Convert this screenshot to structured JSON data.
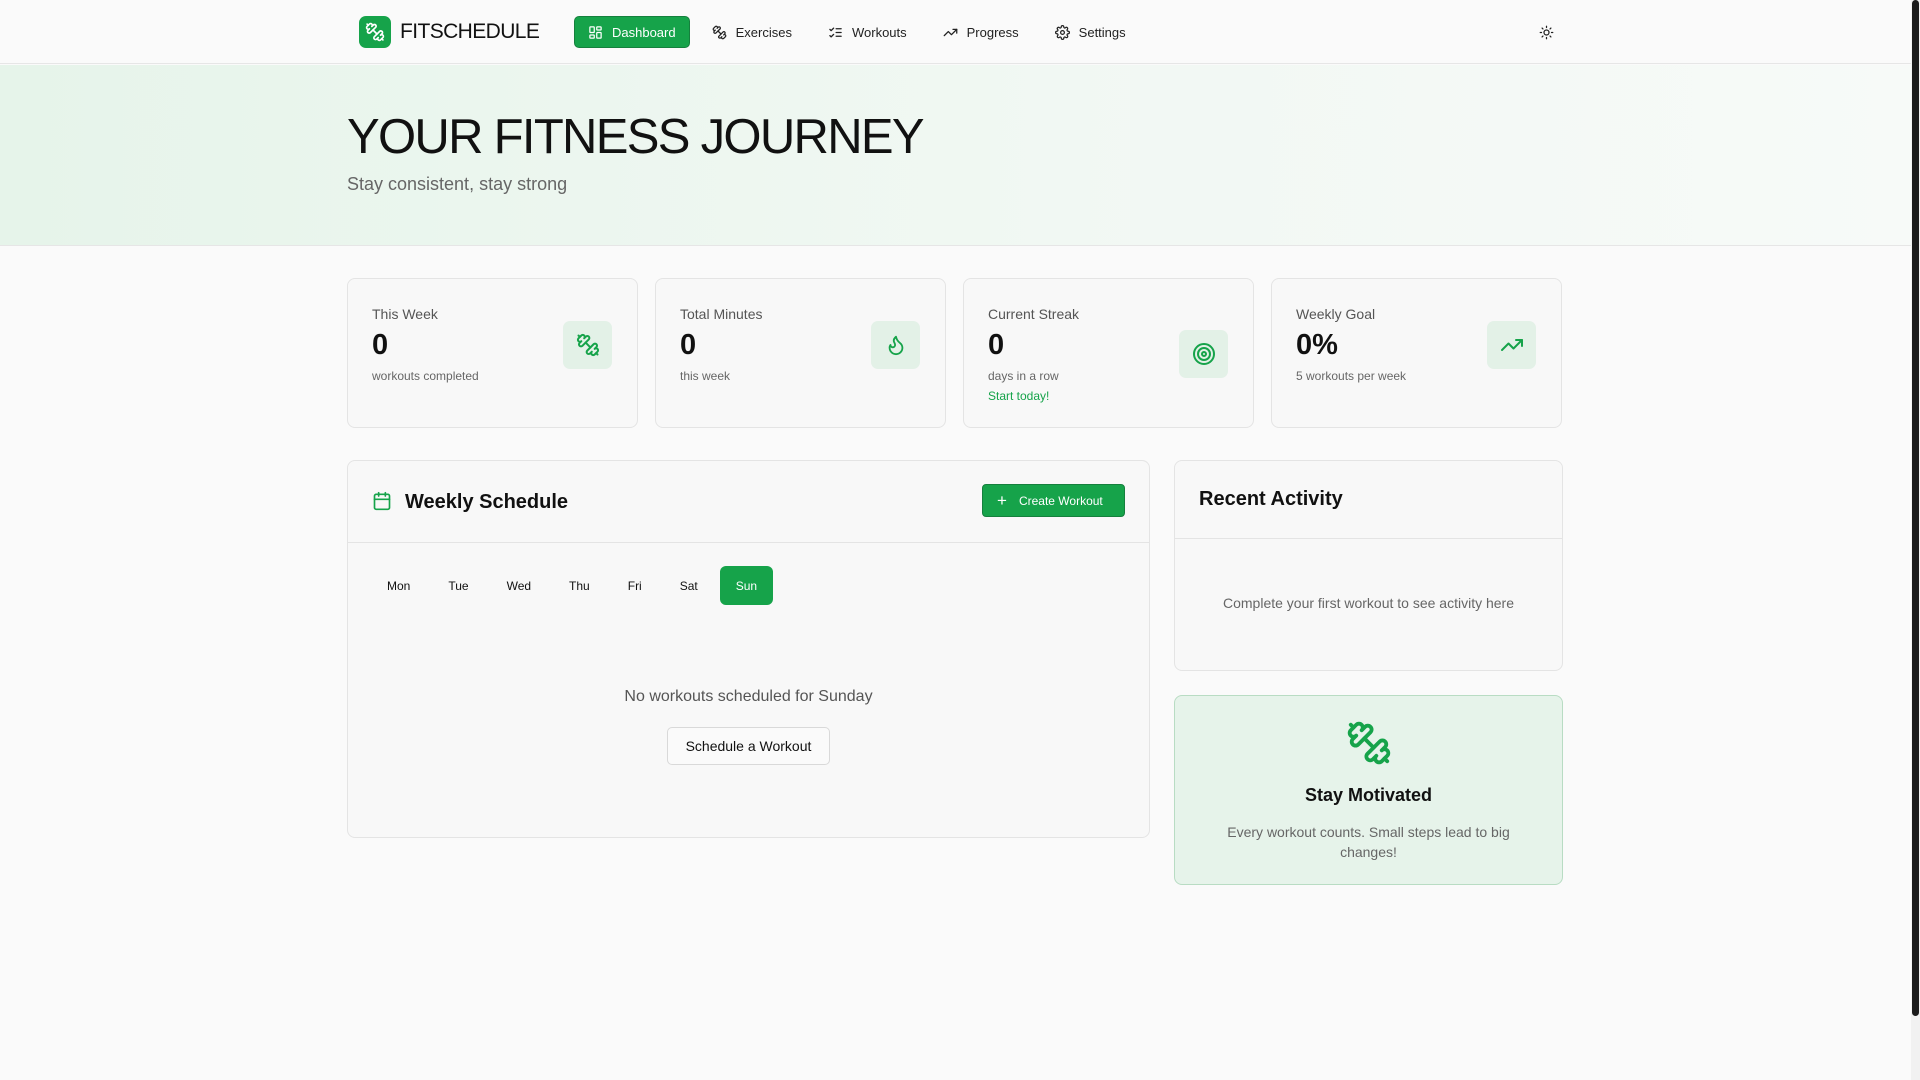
{
  "brand": {
    "name": "FITSCHEDULE",
    "logo_icon": "dumbbell-icon"
  },
  "nav": {
    "items": [
      {
        "label": "Dashboard",
        "icon": "dashboard-icon",
        "active": true
      },
      {
        "label": "Exercises",
        "icon": "dumbbell-icon"
      },
      {
        "label": "Workouts",
        "icon": "list-checks-icon"
      },
      {
        "label": "Progress",
        "icon": "trending-up-icon"
      },
      {
        "label": "Settings",
        "icon": "gear-icon"
      }
    ],
    "theme_toggle_icon": "sun-icon"
  },
  "hero": {
    "title": "YOUR FITNESS JOURNEY",
    "subtitle": "Stay consistent, stay strong"
  },
  "stats": [
    {
      "label": "This Week",
      "value": "0",
      "note": "workouts completed",
      "icon": "dumbbell-icon"
    },
    {
      "label": "Total Minutes",
      "value": "0",
      "note": "this week",
      "icon": "flame-icon"
    },
    {
      "label": "Current Streak",
      "value": "0",
      "note": "days in a row",
      "extra": "Start today!",
      "icon": "target-icon"
    },
    {
      "label": "Weekly Goal",
      "value": "0%",
      "note": "5 workouts per week",
      "icon": "trending-up-icon"
    }
  ],
  "schedule": {
    "title": "Weekly Schedule",
    "create_label": "Create Workout",
    "days": [
      "Mon",
      "Tue",
      "Wed",
      "Thu",
      "Fri",
      "Sat",
      "Sun"
    ],
    "selected_day": "Sun",
    "empty_text": "No workouts scheduled for Sunday",
    "schedule_button": "Schedule a Workout"
  },
  "recent": {
    "title": "Recent Activity",
    "empty_text": "Complete your first workout to see activity here"
  },
  "motivation": {
    "title": "Stay Motivated",
    "text": "Every workout counts. Small steps lead to big changes!"
  },
  "colors": {
    "accent": "#16a34a",
    "accent_soft": "#e3f1e7"
  }
}
